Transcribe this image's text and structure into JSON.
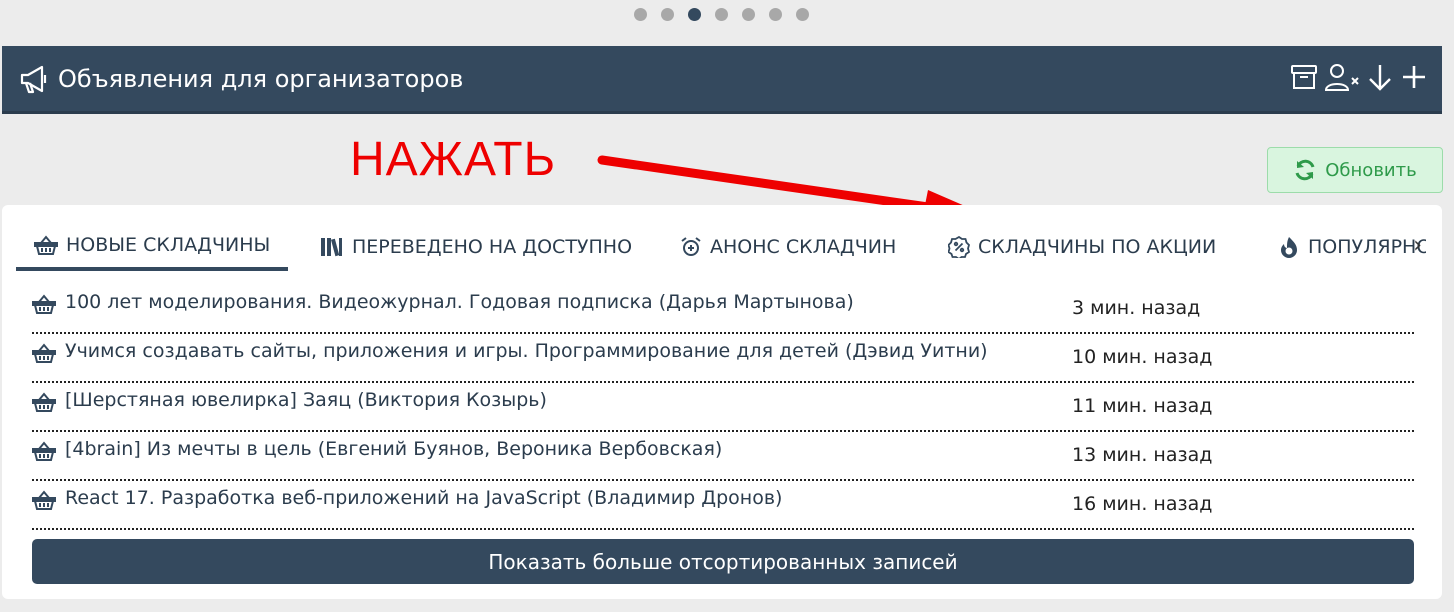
{
  "carousel": {
    "total": 7,
    "active": 3
  },
  "header": {
    "title": "Объявления для организаторов"
  },
  "annotation": {
    "text": "НАЖАТЬ",
    "color": "#ee0000"
  },
  "refresh_label": "Обновить",
  "tabs": [
    {
      "label": "НОВЫЕ СКЛАДЧИНЫ",
      "icon": "basket-icon",
      "active": true
    },
    {
      "label": "ПЕРЕВЕДЕНО НА ДОСТУПНО",
      "icon": "library-icon"
    },
    {
      "label": "АНОНС СКЛАДЧИН",
      "icon": "alarm-icon"
    },
    {
      "label": "СКЛАДЧИНЫ ПО АКЦИИ",
      "icon": "discount-icon"
    },
    {
      "label": "ПОПУЛЯРНО",
      "icon": "fire-icon"
    }
  ],
  "items": [
    {
      "title": "100 лет моделирования. Видеожурнал. Годовая подписка (Дарья Мартынова)",
      "time": "3 мин. назад"
    },
    {
      "title": "Учимся создавать сайты, приложения и игры. Программирование для детей (Дэвид Уитни)",
      "time": "10 мин. назад"
    },
    {
      "title": "[Шерстяная ювелирка] Заяц (Виктория Козырь)",
      "time": "11 мин. назад"
    },
    {
      "title": "[4brain] Из мечты в цель (Евгений Буянов, Вероника Вербовская)",
      "time": "13 мин. назад"
    },
    {
      "title": "React 17. Разработка веб-приложений на JavaScript (Владимир Дронов)",
      "time": "16 мин. назад"
    }
  ],
  "more_label": "Показать больше отсортированных записей",
  "colors": {
    "primary": "#34495e",
    "refresh_bg": "#d9f5df",
    "refresh_fg": "#2e9a4a"
  }
}
